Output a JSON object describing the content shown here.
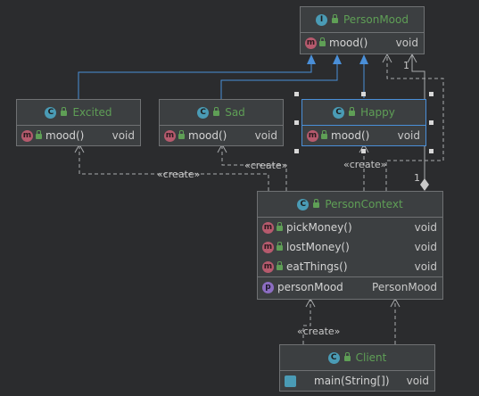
{
  "classes": {
    "person_mood": {
      "title": "PersonMood",
      "badge": "I",
      "methods": [
        {
          "name": "mood()",
          "type": "void"
        }
      ]
    },
    "excited": {
      "title": "Excited",
      "badge": "C",
      "methods": [
        {
          "name": "mood()",
          "type": "void"
        }
      ]
    },
    "sad": {
      "title": "Sad",
      "badge": "C",
      "methods": [
        {
          "name": "mood()",
          "type": "void"
        }
      ]
    },
    "happy": {
      "title": "Happy",
      "badge": "C",
      "methods": [
        {
          "name": "mood()",
          "type": "void"
        }
      ]
    },
    "person_context": {
      "title": "PersonContext",
      "badge": "C",
      "methods": [
        {
          "name": "pickMoney()",
          "type": "void"
        },
        {
          "name": "lostMoney()",
          "type": "void"
        },
        {
          "name": "eatThings()",
          "type": "void"
        }
      ],
      "fields": [
        {
          "name": "personMood",
          "type": "PersonMood",
          "badge": "p"
        }
      ]
    },
    "client": {
      "title": "Client",
      "badge": "C",
      "methods": [
        {
          "name": "main(String[])",
          "type": "void"
        }
      ]
    }
  },
  "method_badge": "m",
  "edges": {
    "create_excited": "«create»",
    "create_sad": "«create»",
    "create_happy": "«create»",
    "create_client": "«create»",
    "multiplicity_top": "1",
    "multiplicity_bottom": "1"
  },
  "colors": {
    "background": "#2b2c2e",
    "node_fill": "#3c3f41",
    "node_border": "#6f7173",
    "selected_border": "#4a8fd8",
    "class_name": "#5f9f56",
    "realization_arrow": "#4a8fd8",
    "dependency_line": "#a9abad"
  }
}
